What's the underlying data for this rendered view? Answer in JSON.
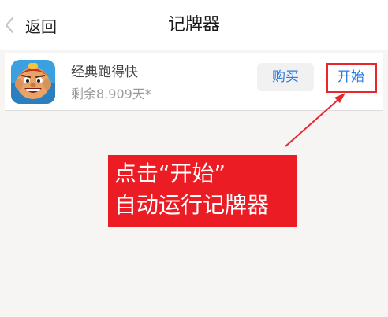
{
  "nav": {
    "back_label": "返回",
    "title": "记牌器"
  },
  "card": {
    "app_name": "经典跑得快",
    "remaining": "剩余8.909天*",
    "buy_label": "购买",
    "start_label": "开始"
  },
  "callout": {
    "line1": "点击“开始”",
    "line2": "自动运行记牌器"
  },
  "colors": {
    "accent": "#2b7be0",
    "highlight": "#e8262b",
    "callout_bg": "#ec1c24"
  },
  "icons": {
    "back": "chevron-left-icon",
    "app": "cartoon-character-app-icon"
  }
}
